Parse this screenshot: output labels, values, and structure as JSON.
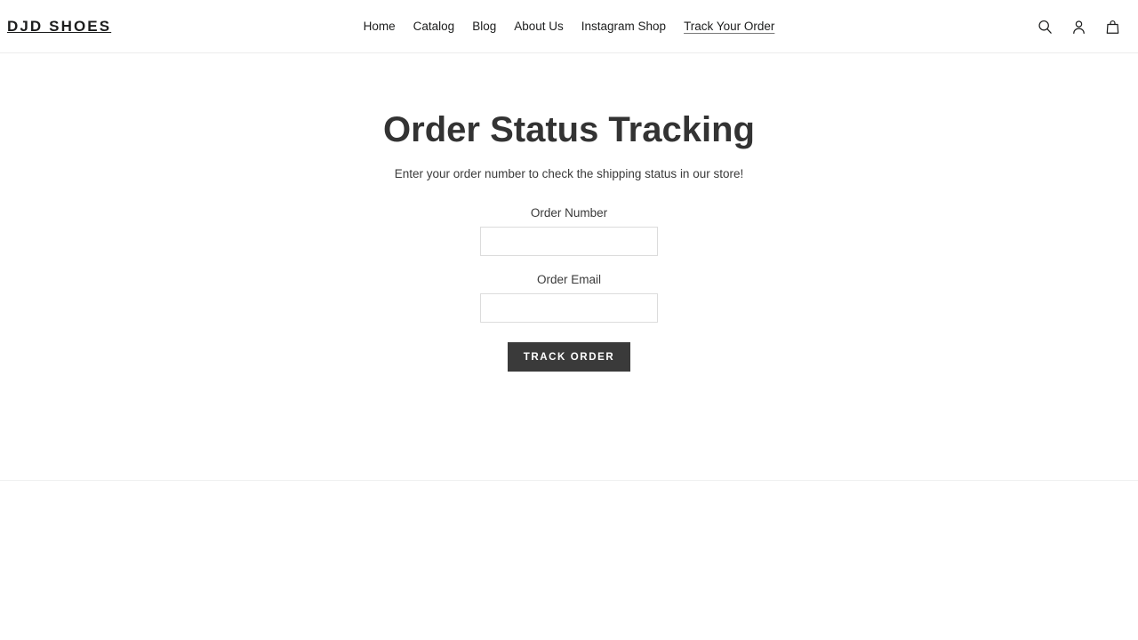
{
  "header": {
    "logo": "DJD SHOES",
    "nav": [
      {
        "label": "Home",
        "active": false
      },
      {
        "label": "Catalog",
        "active": false
      },
      {
        "label": "Blog",
        "active": false
      },
      {
        "label": "About Us",
        "active": false
      },
      {
        "label": "Instagram Shop",
        "active": false
      },
      {
        "label": "Track Your Order",
        "active": true
      }
    ],
    "icons": [
      {
        "name": "search-icon"
      },
      {
        "name": "account-icon"
      },
      {
        "name": "cart-icon"
      }
    ]
  },
  "main": {
    "title": "Order Status Tracking",
    "subtitle": "Enter your order number to check the shipping status in our store!",
    "form": {
      "fields": [
        {
          "label": "Order Number",
          "value": "",
          "placeholder": ""
        },
        {
          "label": "Order Email",
          "value": "",
          "placeholder": ""
        }
      ],
      "submit_label": "Track Order"
    }
  },
  "colors": {
    "text": "#1c1d1d",
    "title": "#333333",
    "button_background": "#3a3a3a",
    "button_text": "#ffffff",
    "input_border": "#dcdcdc",
    "divider": "#eceded",
    "page_background": "#ffffff"
  }
}
